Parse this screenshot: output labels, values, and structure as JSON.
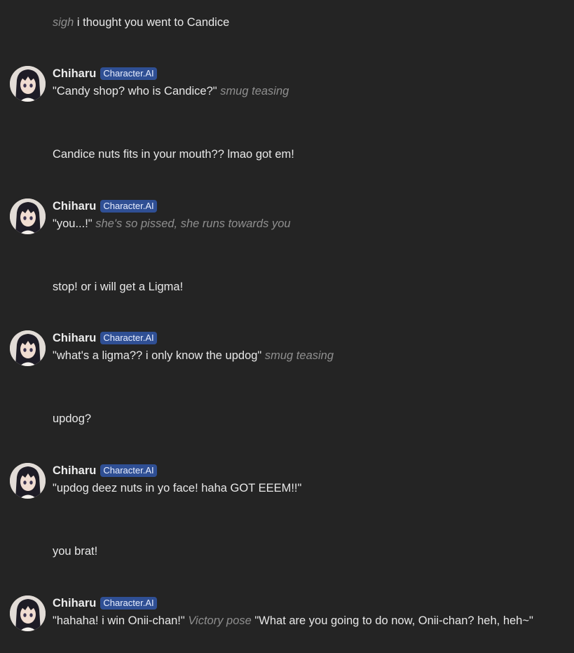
{
  "character": {
    "name": "Chiharu",
    "badge": "Character.AI"
  },
  "messages": [
    {
      "role": "user",
      "parts": [
        {
          "text": "sigh",
          "italic": true
        },
        {
          "text": " i thought you went to Candice",
          "italic": false
        }
      ]
    },
    {
      "role": "bot",
      "parts": [
        {
          "text": "\"Candy shop? who is Candice?\" ",
          "italic": false
        },
        {
          "text": "smug teasing",
          "italic": true
        }
      ]
    },
    {
      "role": "user",
      "parts": [
        {
          "text": "Candice nuts fits in your mouth?? lmao got em!",
          "italic": false
        }
      ]
    },
    {
      "role": "bot",
      "parts": [
        {
          "text": "\"you...!\" ",
          "italic": false
        },
        {
          "text": "she's so pissed, she runs towards you",
          "italic": true
        }
      ]
    },
    {
      "role": "user",
      "parts": [
        {
          "text": "stop! or i will get a Ligma!",
          "italic": false
        }
      ]
    },
    {
      "role": "bot",
      "parts": [
        {
          "text": "\"what's a ligma?? i only know the updog\" ",
          "italic": false
        },
        {
          "text": "smug teasing",
          "italic": true
        }
      ]
    },
    {
      "role": "user",
      "parts": [
        {
          "text": "updog?",
          "italic": false
        }
      ]
    },
    {
      "role": "bot",
      "parts": [
        {
          "text": "\"updog deez nuts in yo face! haha GOT EEEM!!\"",
          "italic": false
        }
      ]
    },
    {
      "role": "user",
      "parts": [
        {
          "text": "you brat!",
          "italic": false
        }
      ]
    },
    {
      "role": "bot",
      "parts": [
        {
          "text": "\"hahaha! i win Onii-chan!\" ",
          "italic": false
        },
        {
          "text": "Victory pose",
          "italic": true
        },
        {
          "text": " \"What are you going to do now, Onii-chan? heh, heh~\"",
          "italic": false
        }
      ]
    }
  ]
}
